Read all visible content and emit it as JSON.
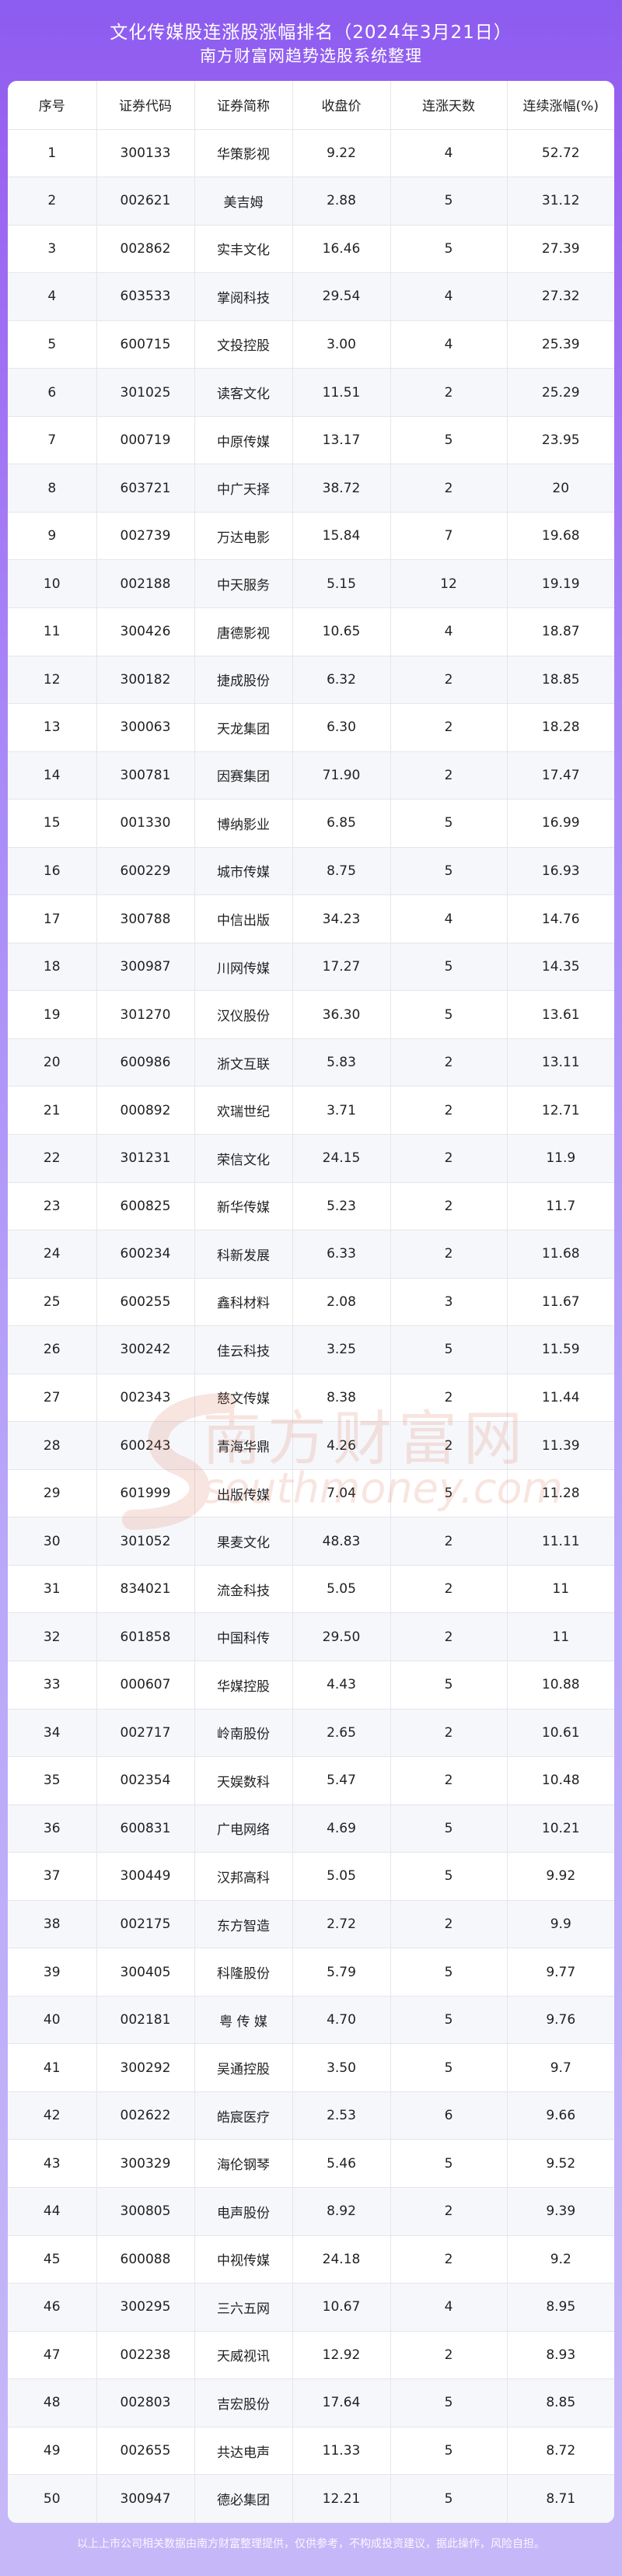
{
  "header": {
    "title": "文化传媒股连涨股涨幅排名（2024年3月21日）",
    "subtitle": "南方财富网趋势选股系统整理"
  },
  "table": {
    "columns": [
      "序号",
      "证券代码",
      "证券简称",
      "收盘价",
      "连涨天数",
      "连续涨幅(%)"
    ],
    "rows": [
      [
        "1",
        "300133",
        "华策影视",
        "9.22",
        "4",
        "52.72"
      ],
      [
        "2",
        "002621",
        "美吉姆",
        "2.88",
        "5",
        "31.12"
      ],
      [
        "3",
        "002862",
        "实丰文化",
        "16.46",
        "5",
        "27.39"
      ],
      [
        "4",
        "603533",
        "掌阅科技",
        "29.54",
        "4",
        "27.32"
      ],
      [
        "5",
        "600715",
        "文投控股",
        "3.00",
        "4",
        "25.39"
      ],
      [
        "6",
        "301025",
        "读客文化",
        "11.51",
        "2",
        "25.29"
      ],
      [
        "7",
        "000719",
        "中原传媒",
        "13.17",
        "5",
        "23.95"
      ],
      [
        "8",
        "603721",
        "中广天择",
        "38.72",
        "2",
        "20"
      ],
      [
        "9",
        "002739",
        "万达电影",
        "15.84",
        "7",
        "19.68"
      ],
      [
        "10",
        "002188",
        "中天服务",
        "5.15",
        "12",
        "19.19"
      ],
      [
        "11",
        "300426",
        "唐德影视",
        "10.65",
        "4",
        "18.87"
      ],
      [
        "12",
        "300182",
        "捷成股份",
        "6.32",
        "2",
        "18.85"
      ],
      [
        "13",
        "300063",
        "天龙集团",
        "6.30",
        "2",
        "18.28"
      ],
      [
        "14",
        "300781",
        "因赛集团",
        "71.90",
        "2",
        "17.47"
      ],
      [
        "15",
        "001330",
        "博纳影业",
        "6.85",
        "5",
        "16.99"
      ],
      [
        "16",
        "600229",
        "城市传媒",
        "8.75",
        "5",
        "16.93"
      ],
      [
        "17",
        "300788",
        "中信出版",
        "34.23",
        "4",
        "14.76"
      ],
      [
        "18",
        "300987",
        "川网传媒",
        "17.27",
        "5",
        "14.35"
      ],
      [
        "19",
        "301270",
        "汉仪股份",
        "36.30",
        "5",
        "13.61"
      ],
      [
        "20",
        "600986",
        "浙文互联",
        "5.83",
        "2",
        "13.11"
      ],
      [
        "21",
        "000892",
        "欢瑞世纪",
        "3.71",
        "2",
        "12.71"
      ],
      [
        "22",
        "301231",
        "荣信文化",
        "24.15",
        "2",
        "11.9"
      ],
      [
        "23",
        "600825",
        "新华传媒",
        "5.23",
        "2",
        "11.7"
      ],
      [
        "24",
        "600234",
        "科新发展",
        "6.33",
        "2",
        "11.68"
      ],
      [
        "25",
        "600255",
        "鑫科材料",
        "2.08",
        "3",
        "11.67"
      ],
      [
        "26",
        "300242",
        "佳云科技",
        "3.25",
        "5",
        "11.59"
      ],
      [
        "27",
        "002343",
        "慈文传媒",
        "8.38",
        "2",
        "11.44"
      ],
      [
        "28",
        "600243",
        "青海华鼎",
        "4.26",
        "2",
        "11.39"
      ],
      [
        "29",
        "601999",
        "出版传媒",
        "7.04",
        "5",
        "11.28"
      ],
      [
        "30",
        "301052",
        "果麦文化",
        "48.83",
        "2",
        "11.11"
      ],
      [
        "31",
        "834021",
        "流金科技",
        "5.05",
        "2",
        "11"
      ],
      [
        "32",
        "601858",
        "中国科传",
        "29.50",
        "2",
        "11"
      ],
      [
        "33",
        "000607",
        "华媒控股",
        "4.43",
        "5",
        "10.88"
      ],
      [
        "34",
        "002717",
        "岭南股份",
        "2.65",
        "2",
        "10.61"
      ],
      [
        "35",
        "002354",
        "天娱数科",
        "5.47",
        "2",
        "10.48"
      ],
      [
        "36",
        "600831",
        "广电网络",
        "4.69",
        "5",
        "10.21"
      ],
      [
        "37",
        "300449",
        "汉邦高科",
        "5.05",
        "5",
        "9.92"
      ],
      [
        "38",
        "002175",
        "东方智造",
        "2.72",
        "2",
        "9.9"
      ],
      [
        "39",
        "300405",
        "科隆股份",
        "5.79",
        "5",
        "9.77"
      ],
      [
        "40",
        "002181",
        "粤 传 媒",
        "4.70",
        "5",
        "9.76"
      ],
      [
        "41",
        "300292",
        "吴通控股",
        "3.50",
        "5",
        "9.7"
      ],
      [
        "42",
        "002622",
        "皓宸医疗",
        "2.53",
        "6",
        "9.66"
      ],
      [
        "43",
        "300329",
        "海伦钢琴",
        "5.46",
        "5",
        "9.52"
      ],
      [
        "44",
        "300805",
        "电声股份",
        "8.92",
        "2",
        "9.39"
      ],
      [
        "45",
        "600088",
        "中视传媒",
        "24.18",
        "2",
        "9.2"
      ],
      [
        "46",
        "300295",
        "三六五网",
        "10.67",
        "4",
        "8.95"
      ],
      [
        "47",
        "002238",
        "天威视讯",
        "12.92",
        "2",
        "8.93"
      ],
      [
        "48",
        "002803",
        "吉宏股份",
        "17.64",
        "5",
        "8.85"
      ],
      [
        "49",
        "002655",
        "共达电声",
        "11.33",
        "5",
        "8.72"
      ],
      [
        "50",
        "300947",
        "德必集团",
        "12.21",
        "5",
        "8.71"
      ]
    ]
  },
  "watermark": {
    "text_cn": "南方财富网",
    "text_en": "southmoney.com"
  },
  "footer": {
    "text": "以上上市公司相关数据由南方财富整理提供，仅供参考，不构成投资建议，据此操作，风险自担。"
  },
  "colors": {
    "background_top": "#8C5CF0",
    "background_bottom": "#C6B8F8",
    "watermark": "#d35a3a"
  }
}
